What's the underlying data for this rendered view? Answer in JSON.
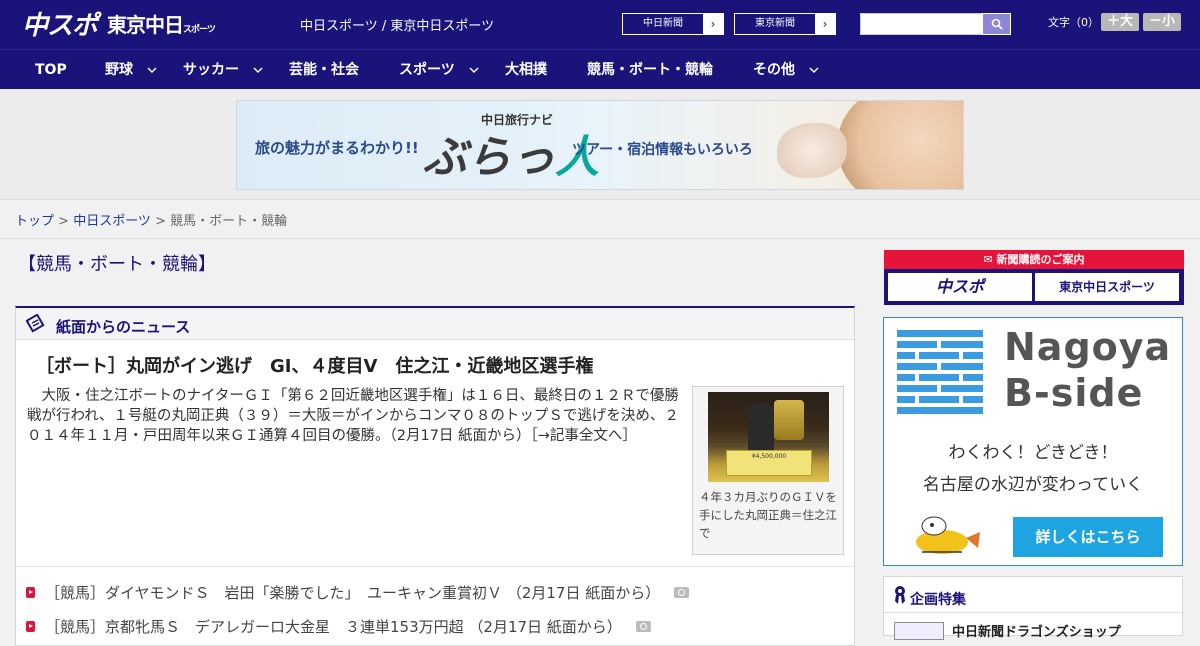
{
  "header": {
    "logo_main": "中スポ",
    "logo_sub": "東京中日",
    "logo_sub_small": "スポーツ",
    "site_title": "中日スポーツ / 東京中日スポーツ",
    "btn_chunichi": "中日新聞",
    "btn_tokyo": "東京新聞",
    "search_placeholder": "",
    "font_label": "文字（0）",
    "font_larger": "＋大",
    "font_smaller": "－小"
  },
  "nav": {
    "items": [
      {
        "label": "TOP"
      },
      {
        "label": "野球"
      },
      {
        "label": "サッカー"
      },
      {
        "label": "芸能・社会"
      },
      {
        "label": "スポーツ"
      },
      {
        "label": "大相撲"
      },
      {
        "label": "競馬・ボート・競輪"
      },
      {
        "label": "その他"
      }
    ]
  },
  "ad": {
    "lead": "旅の魅力がまるわかり!!",
    "navi": "中日旅行ナビ",
    "brand_a": "ぶらっ",
    "brand_b": "人",
    "tail": "ツアー・宿泊情報もいろいろ"
  },
  "breadcrumb": {
    "top": "トップ",
    "sep1": " > ",
    "section": "中日スポーツ",
    "sep2": " > ",
    "current": "競馬・ボート・競輪"
  },
  "page_title": "【競馬・ボート・競輪】",
  "main": {
    "section_title": "紙面からのニュース",
    "article": {
      "title": "［ボート］丸岡がイン逃げ　GI、４度目V　住之江・近畿地区選手権",
      "body": "大阪・住之江ボートのナイターＧＩ「第６２回近畿地区選手権」は１６日、最終日の１２Ｒで優勝戦が行われ、１号艇の丸岡正典（３９）＝大阪＝がインからコンマ０８のトップＳで逃げを決め、２０１４年１１月・戸田周年以来ＧＩ通算４回目の優勝。（2月17日 紙面から）［→記事全文へ］",
      "photo_board_text": "¥4,500,000",
      "photo_caption": "４年３カ月ぶりのＧＩＶを手にした丸岡正典＝住之江で"
    },
    "news": [
      {
        "text": "［競馬］ダイヤモンドＳ　岩田「楽勝でした」　ユーキャン重賞初Ｖ （2月17日 紙面から）"
      },
      {
        "text": "［競馬］京都牝馬Ｓ　デアレガーロ大金星　３連単153万円超 （2月17日 紙面から）"
      }
    ]
  },
  "sidebar": {
    "sub_head": "新聞購読のご案内",
    "sub_logo_a": "中スポ",
    "sub_logo_b": "東京中日スポーツ",
    "bside_title_1": "Nagoya",
    "bside_title_2": "B-side",
    "bside_line1": "わくわく！どきどき！",
    "bside_line2": "名古屋の水辺が変わっていく",
    "bside_cta": "詳しくはこちら",
    "feature_title": "企画特集",
    "feature_item": "中日新聞ドラゴンズショップ"
  },
  "colors": {
    "brand": "#1a147a",
    "accent_red": "#e6133b",
    "bside_blue": "#1ea4e0"
  }
}
